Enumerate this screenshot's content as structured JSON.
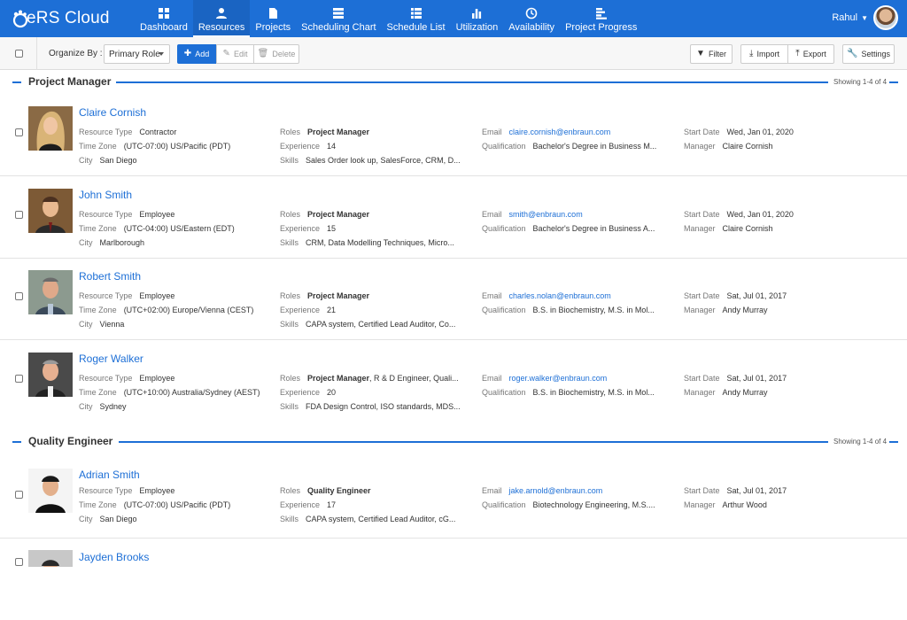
{
  "app": {
    "title": "eRS Cloud"
  },
  "nav": [
    {
      "label": "Dashboard",
      "icon": "dashboard-icon"
    },
    {
      "label": "Resources",
      "icon": "resources-icon",
      "active": true
    },
    {
      "label": "Projects",
      "icon": "projects-icon"
    },
    {
      "label": "Scheduling Chart",
      "icon": "scheduling-chart-icon"
    },
    {
      "label": "Schedule List",
      "icon": "schedule-list-icon"
    },
    {
      "label": "Utilization",
      "icon": "utilization-icon"
    },
    {
      "label": "Availability",
      "icon": "availability-icon"
    },
    {
      "label": "Project Progress",
      "icon": "project-progress-icon"
    }
  ],
  "user": {
    "name": "Rahul"
  },
  "toolbar": {
    "organize_label": "Organize By :",
    "organize_value": "Primary Role",
    "add": "Add",
    "edit": "Edit",
    "delete": "Delete",
    "filter": "Filter",
    "import": "Import",
    "export": "Export",
    "settings": "Settings"
  },
  "labels": {
    "resource_type": "Resource Type",
    "time_zone": "Time Zone",
    "city": "City",
    "roles": "Roles",
    "experience": "Experience",
    "skills": "Skills",
    "email": "Email",
    "qualification": "Qualification",
    "start_date": "Start Date",
    "manager": "Manager"
  },
  "sections": [
    {
      "title": "Project Manager",
      "count": "Showing 1-4 of 4"
    },
    {
      "title": "Quality Engineer",
      "count": "Showing 1-4 of 4"
    }
  ],
  "resources": [
    {
      "name": "Claire Cornish",
      "resource_type": "Contractor",
      "time_zone": "(UTC-07:00) US/Pacific (PDT)",
      "city": "San Diego",
      "roles_bold": "Project Manager",
      "roles_rest": "",
      "experience": "14",
      "skills": "Sales Order look up, SalesForce, CRM, D...",
      "email": "claire.cornish@enbraun.com",
      "qualification": "Bachelor's Degree in Business M...",
      "start_date": "Wed, Jan 01, 2020",
      "manager": "Claire Cornish"
    },
    {
      "name": "John Smith",
      "resource_type": "Employee",
      "time_zone": "(UTC-04:00) US/Eastern (EDT)",
      "city": "Marlborough",
      "roles_bold": "Project Manager",
      "roles_rest": "",
      "experience": "15",
      "skills": "CRM, Data Modelling Techniques, Micro...",
      "email": "smith@enbraun.com",
      "qualification": "Bachelor's Degree in Business A...",
      "start_date": "Wed, Jan 01, 2020",
      "manager": "Claire Cornish"
    },
    {
      "name": "Robert Smith",
      "resource_type": "Employee",
      "time_zone": "(UTC+02:00) Europe/Vienna (CEST)",
      "city": "Vienna",
      "roles_bold": "Project Manager",
      "roles_rest": "",
      "experience": "21",
      "skills": "CAPA system, Certified Lead Auditor, Co...",
      "email": "charles.nolan@enbraun.com",
      "qualification": "B.S. in Biochemistry, M.S. in Mol...",
      "start_date": "Sat, Jul 01, 2017",
      "manager": "Andy Murray"
    },
    {
      "name": "Roger Walker",
      "resource_type": "Employee",
      "time_zone": "(UTC+10:00) Australia/Sydney (AEST)",
      "city": "Sydney",
      "roles_bold": "Project Manager",
      "roles_rest": ", R & D Engineer, Quali...",
      "experience": "20",
      "skills": "FDA Design Control, ISO standards, MDS...",
      "email": "roger.walker@enbraun.com",
      "qualification": "B.S. in Biochemistry, M.S. in Mol...",
      "start_date": "Sat, Jul 01, 2017",
      "manager": "Andy Murray"
    },
    {
      "name": "Adrian Smith",
      "resource_type": "Employee",
      "time_zone": "(UTC-07:00) US/Pacific (PDT)",
      "city": "San Diego",
      "roles_bold": "Quality Engineer",
      "roles_rest": "",
      "experience": "17",
      "skills": "CAPA system, Certified Lead Auditor, cG...",
      "email": "jake.arnold@enbraun.com",
      "qualification": "Biotechnology Engineering, M.S....",
      "start_date": "Sat, Jul 01, 2017",
      "manager": "Arthur Wood"
    },
    {
      "name": "Jayden Brooks"
    }
  ],
  "colors": {
    "primary": "#1d6fd6"
  }
}
